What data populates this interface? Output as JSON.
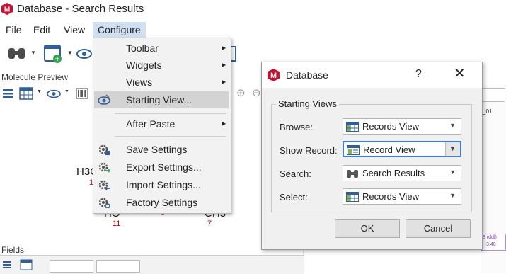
{
  "window": {
    "title": "Database - Search Results"
  },
  "menubar": {
    "items": [
      "File",
      "Edit",
      "View",
      "Configure"
    ]
  },
  "pane": {
    "molecule_preview": "Molecule Preview",
    "fields": "Fields"
  },
  "molecule": {
    "h3c": "H3C",
    "ho": "HO",
    "ch3": "CH3",
    "n11": "11",
    "n6": "6",
    "n7": "7",
    "n1": "1"
  },
  "configure_menu": {
    "toolbar": "Toolbar",
    "widgets": "Widgets",
    "views": "Views",
    "starting_view": "Starting View...",
    "after_paste": "After Paste",
    "save_settings": "Save Settings",
    "export_settings": "Export Settings...",
    "import_settings": "Import Settings...",
    "factory_settings": "Factory Settings"
  },
  "dialog": {
    "title": "Database",
    "help": "?",
    "close": "✕",
    "group_title": "Starting Views",
    "browse_label": "Browse:",
    "browse_value": "Records View",
    "show_record_label": "Show Record:",
    "show_record_value": "Record View",
    "search_label": "Search:",
    "search_value": "Search Results",
    "select_label": "Select:",
    "select_value": "Records View",
    "ok": "OK",
    "cancel": "Cancel"
  },
  "right_pane": {
    "id_text": "_01",
    "ddl_text": "8 (ddl)",
    "num_text": "3.40"
  },
  "colors": {
    "accent": "#3c7fd6",
    "logo": "#c8102e",
    "menu_highlight": "#cfe0f3"
  }
}
